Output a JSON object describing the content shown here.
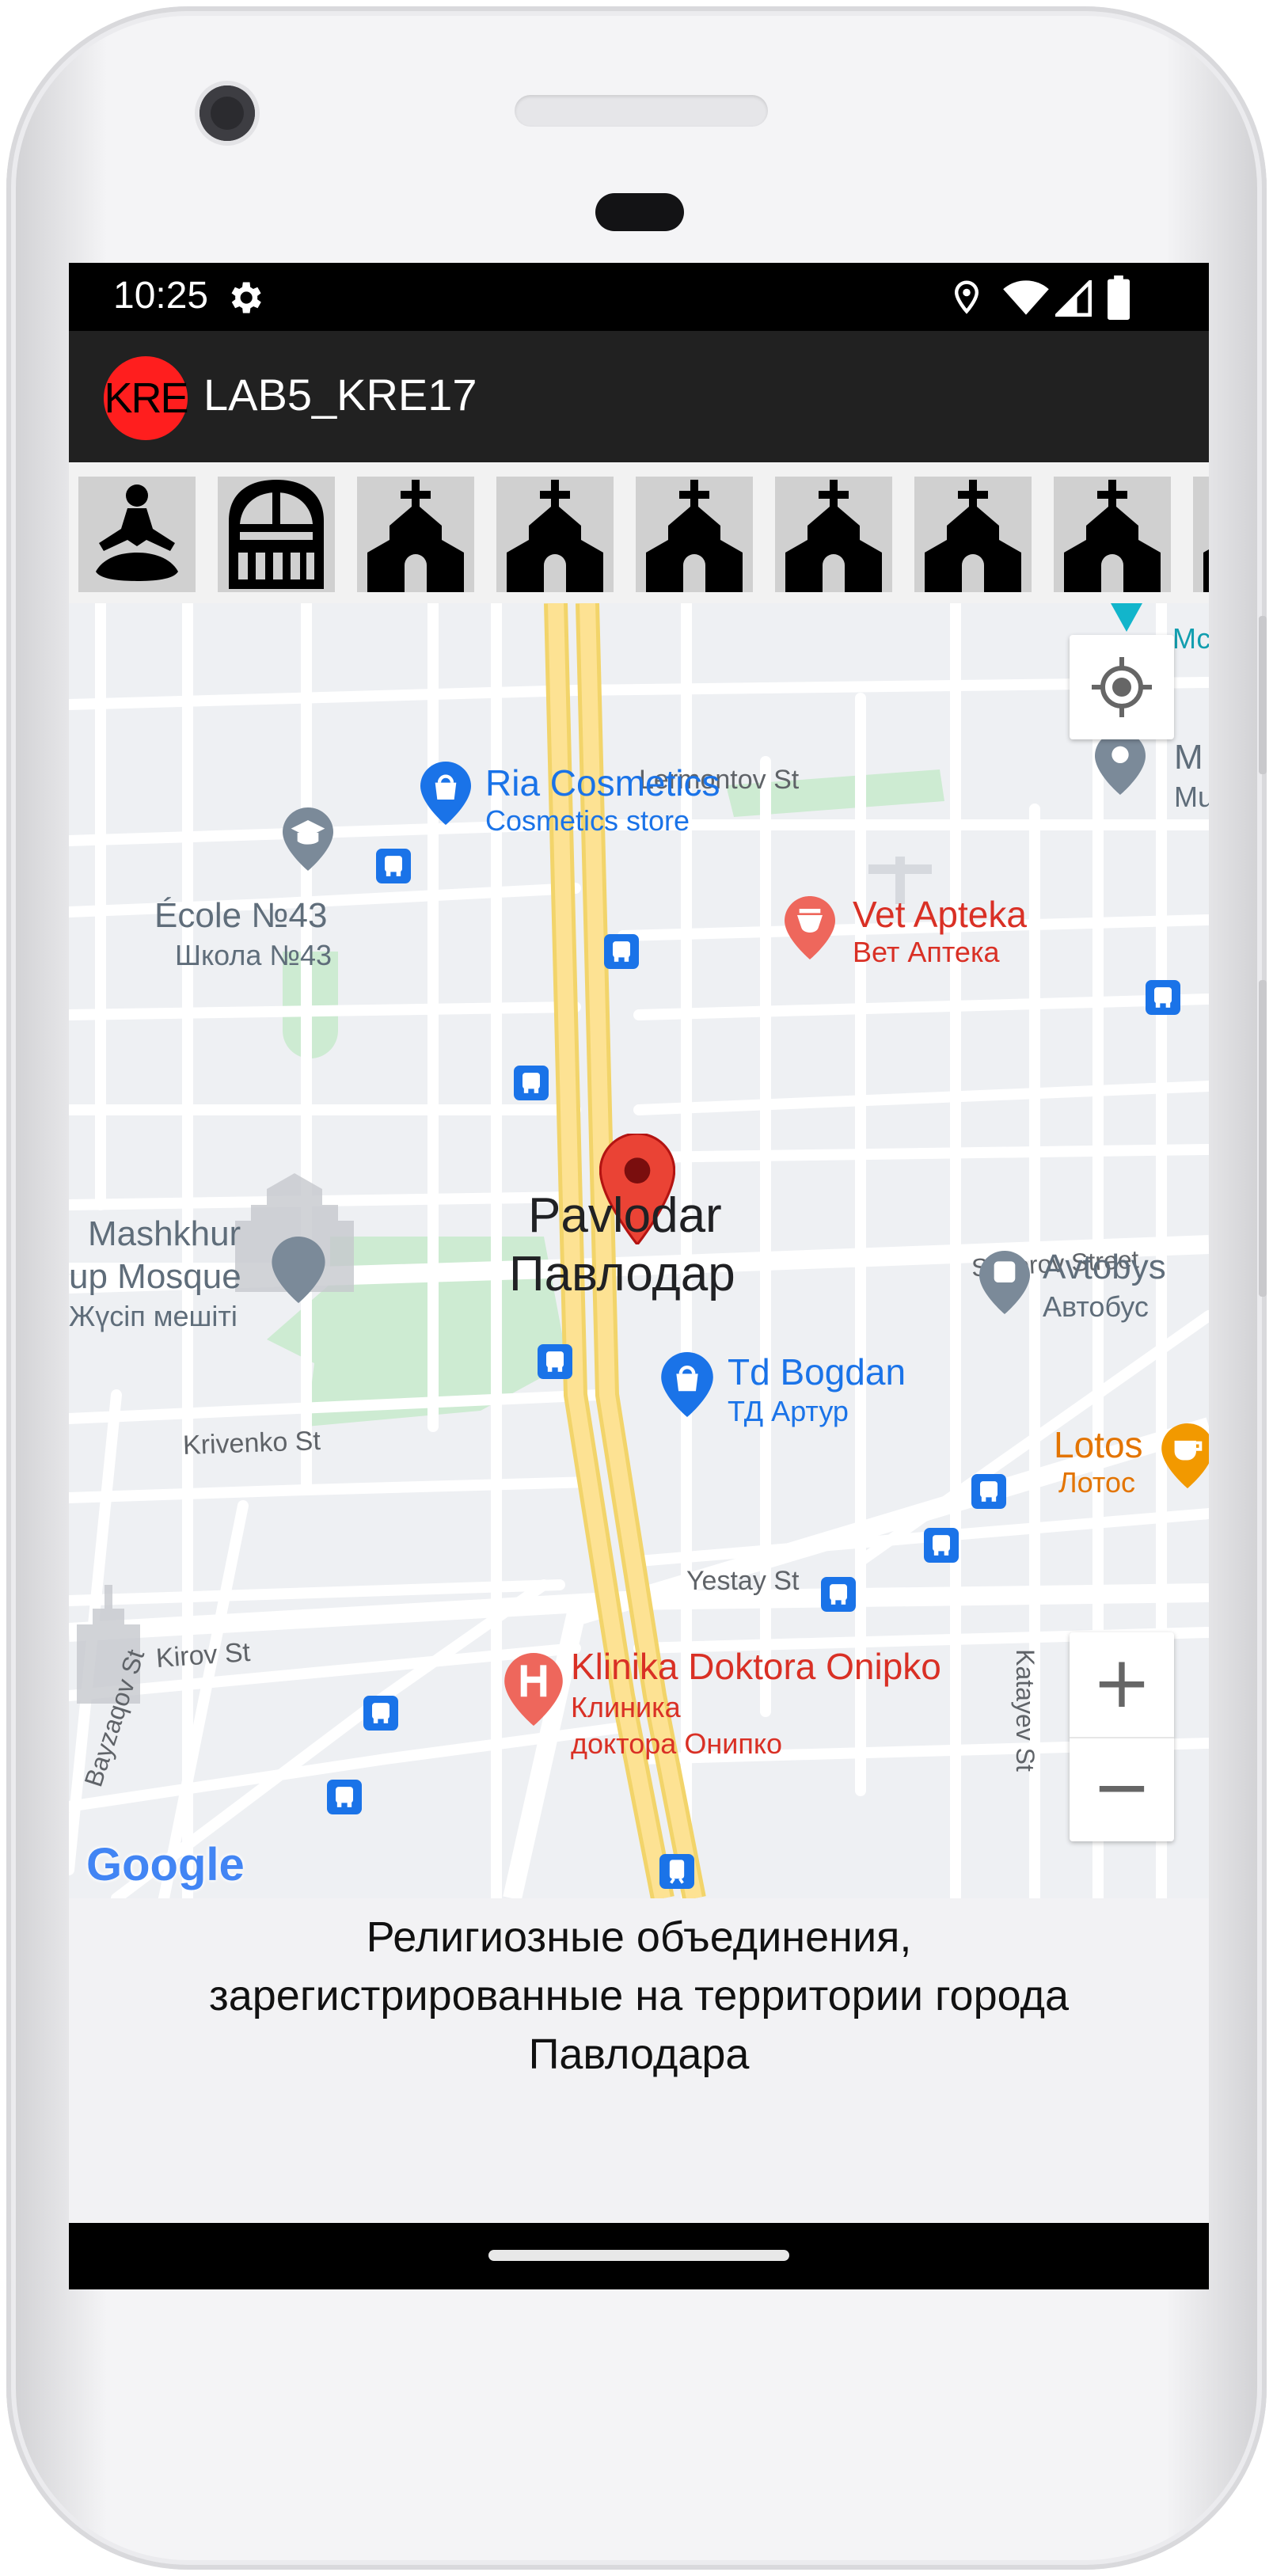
{
  "status_bar": {
    "time": "10:25",
    "icons": [
      "settings-icon",
      "location-icon",
      "wifi-icon",
      "cell-signal-icon",
      "battery-icon"
    ]
  },
  "app_bar": {
    "logo_text": "KRE",
    "title": "LAB5_KRE17"
  },
  "category_icons": [
    "meditation-icon",
    "mosque-icon",
    "church-icon",
    "church-icon",
    "church-icon",
    "church-icon",
    "church-icon",
    "church-icon",
    "church-icon"
  ],
  "map": {
    "places": {
      "ria_cosmetics": {
        "name": "Ria Cosmetics",
        "sub": "Cosmetics store"
      },
      "lermontov": "Lermontov St",
      "school": {
        "name": "École №43",
        "sub": "Школа №43"
      },
      "vet_apteka": {
        "name": "Vet Apteka",
        "sub": "Вет Аптека"
      },
      "marker": {
        "name": "Pavlodar",
        "sub": "Павлодар"
      },
      "mosque": {
        "name1": "Mashkhur",
        "name2": "up Mosque",
        "sub": "Жүсіп мешіті"
      },
      "suvorov": "Suvorov Street",
      "avtobys": {
        "name": "Avtobys",
        "sub": "Автобус"
      },
      "td_bogdan": {
        "name": "Td Bogdan",
        "sub": "ТД Артур"
      },
      "krivenko": "Krivenko St",
      "lotos": {
        "name": "Lotos",
        "sub": "Лотос"
      },
      "yestay": "Yestay St",
      "kirov": "Kirov St",
      "bayzaqov": "Bayzaqov St",
      "katayev": "Katayev St",
      "klinika": {
        "name": "Klinika Doktora Onipko",
        "sub1": "Клиника",
        "sub2": "доктора Онипко"
      },
      "edge_top": "Мс",
      "edge_m": "М",
      "edge_mu": "Mu",
      "google": "Google"
    },
    "controls": {
      "zoom_in": "+",
      "zoom_out": "−"
    },
    "colors": {
      "red_poi": "#d93025",
      "blue_poi": "#1a73e8",
      "orange_poi": "#e37400",
      "park": "#cdebd2",
      "road_major": "#fde293"
    }
  },
  "caption": {
    "line1": "Религиозные объединения,",
    "line2": "зарегистрированные на территории города",
    "line3": "Павлодара"
  }
}
